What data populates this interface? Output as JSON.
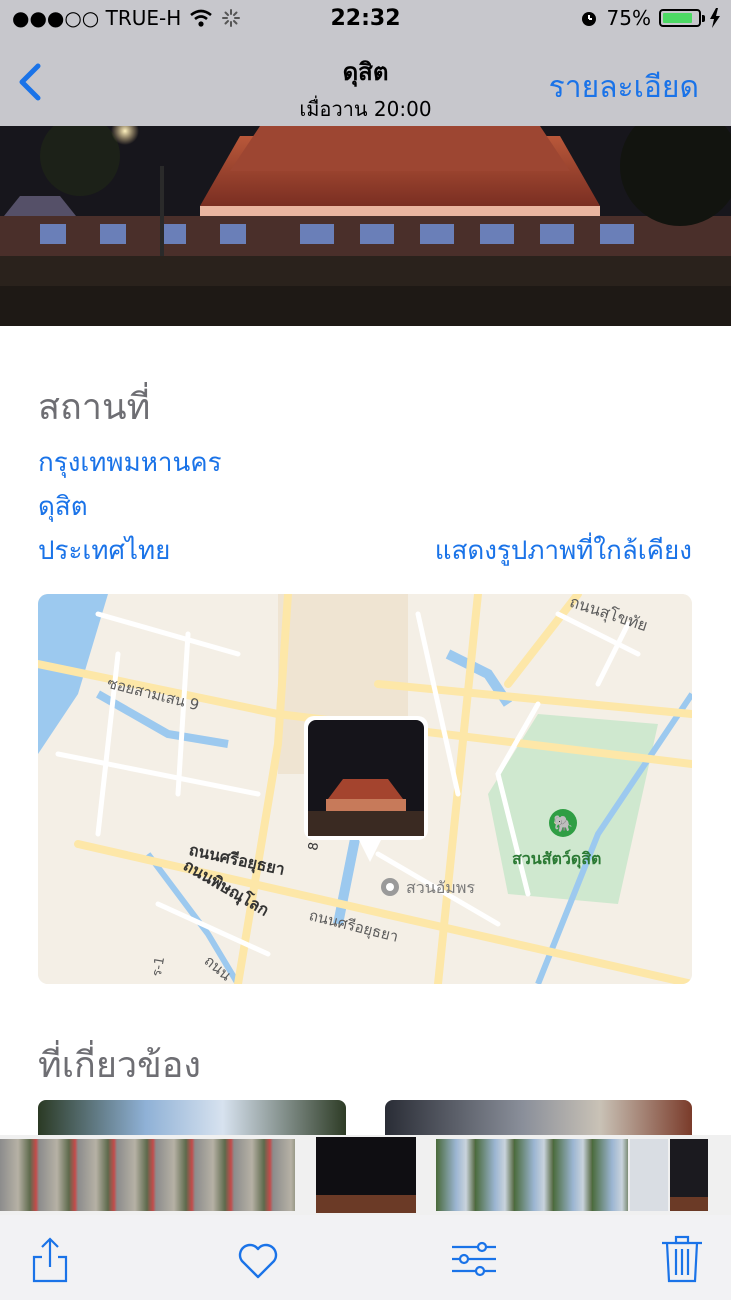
{
  "status_bar": {
    "carrier": "●●●○○ TRUE-H",
    "time": "22:32",
    "battery": "75%",
    "battery_level": 0.75
  },
  "nav": {
    "back_icon": "chevron-left-icon",
    "title": "ดุสิต",
    "subtitle": "เมื่อวาน  20:00",
    "details_label": "รายละเอียด"
  },
  "places": {
    "heading": "สถานที่",
    "city": "กรุงเทพมหานคร",
    "district": "ดุสิต",
    "country": "ประเทศไทย",
    "show_nearby": "แสดงรูปภาพที่ใกล้เคียง"
  },
  "map": {
    "street_samsen": "ซอยสามเสน 9",
    "street_sukhothai": "ถนนสุโขทัย",
    "street_sri_ayutthaya_1": "ถนนศรีอยุธยา",
    "street_phitsanulok": "ถนนพิษณุโลก",
    "street_sri_ayutthaya_2": "ถนนศรีอยุธยา",
    "street_partial": "ถนน",
    "street_partial_2": "ร-1",
    "road_number": "8",
    "zoo_label": "สวนสัตว์ดุสิต",
    "park_label": "สวนอัมพร"
  },
  "related": {
    "heading": "ที่เกี่ยวข้อง"
  },
  "colors": {
    "accent": "#1a73e8",
    "bar_background": "#c7c7cc",
    "battery_green": "#4cd964",
    "map_park": "#cfe8cf",
    "map_road": "#fde7a8",
    "map_water": "#9cc9ef"
  },
  "toolbar": {
    "share_icon": "share-icon",
    "favorite_icon": "heart-icon",
    "edit_icon": "adjust-sliders-icon",
    "delete_icon": "trash-icon"
  }
}
